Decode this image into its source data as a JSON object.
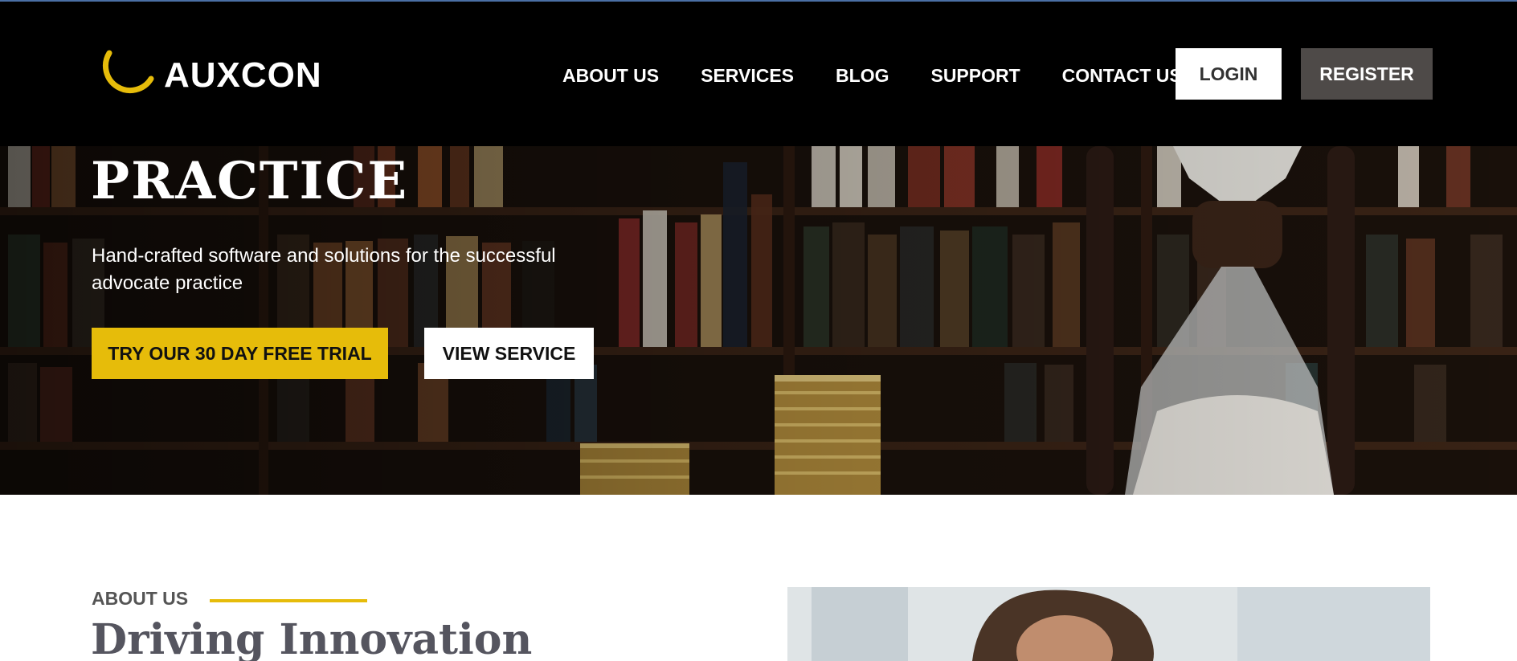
{
  "brand": {
    "name": "AUXCON",
    "accent_color": "#e6bc0a"
  },
  "nav": {
    "items": [
      {
        "label": "ABOUT US"
      },
      {
        "label": "SERVICES"
      },
      {
        "label": "BLOG"
      },
      {
        "label": "SUPPORT"
      },
      {
        "label": "CONTACT US"
      }
    ],
    "login_label": "LOGIN",
    "register_label": "REGISTER"
  },
  "hero": {
    "title": "PRACTICE",
    "subtitle": "Hand-crafted software and solutions for the successful advocate practice",
    "trial_button": "TRY OUR 30 DAY FREE TRIAL",
    "view_button": "VIEW SERVICE",
    "background_icon": "bookshelf-hourglass-coins-image"
  },
  "about": {
    "label": "ABOUT US",
    "title": "Driving Innovation",
    "photo_icon": "woman-portrait-image"
  }
}
